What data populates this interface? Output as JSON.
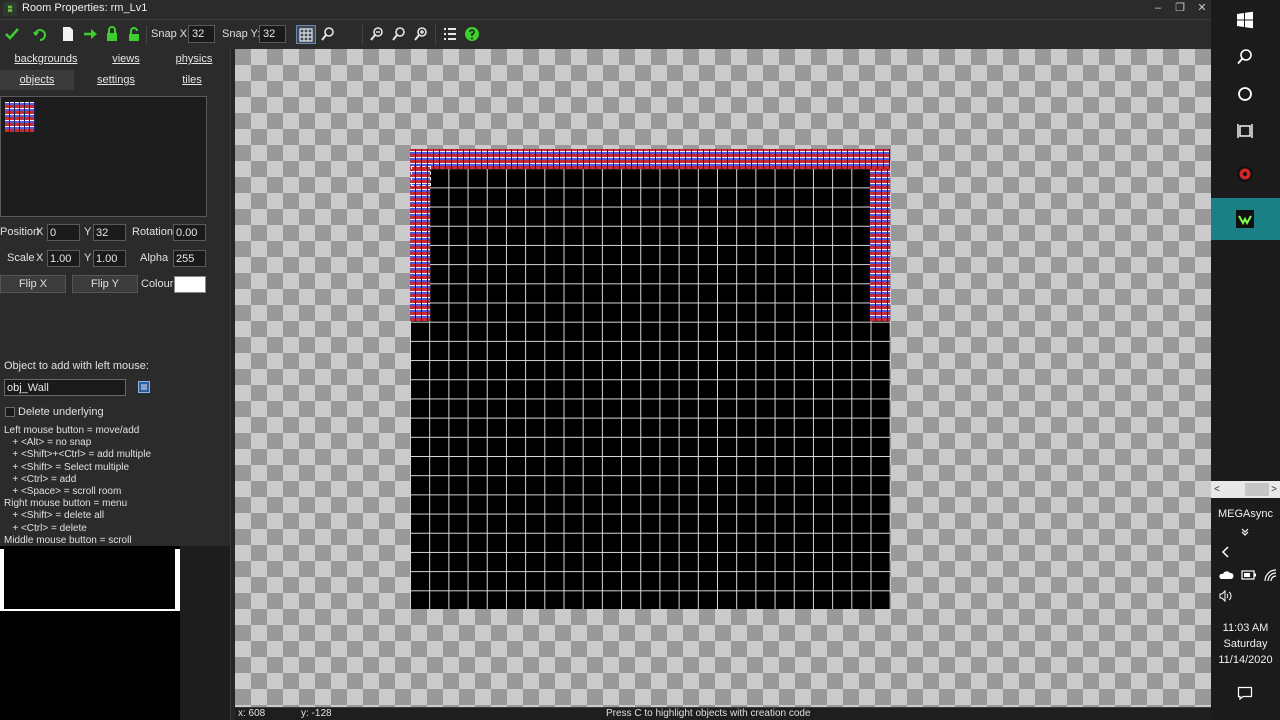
{
  "window": {
    "title": "Room Properties: rm_Lv1",
    "minimize": "–",
    "restore": "❐",
    "close": "✕",
    "app_icon": "gm-logo-icon"
  },
  "toolbar": {
    "snap_x_label": "Snap X:",
    "snap_x_value": "32",
    "snap_y_label": "Snap Y:",
    "snap_y_value": "32"
  },
  "tabs": {
    "row1": [
      "backgrounds",
      "views",
      "physics"
    ],
    "row2": [
      "objects",
      "settings",
      "tiles"
    ],
    "selected": "objects"
  },
  "props": {
    "position_label": "Position",
    "x_label": "X",
    "x_value": "0",
    "y_label": "Y",
    "y_value": "32",
    "rotation_label": "Rotation",
    "rotation_value": "0.00",
    "scale_label": "Scale",
    "scale_x_value": "1.00",
    "scale_y_value": "1.00",
    "alpha_label": "Alpha",
    "alpha_value": "255",
    "flip_x": "Flip X",
    "flip_y": "Flip Y",
    "colour_label": "Colour",
    "colour_value": "#ffffff"
  },
  "object_add": {
    "label": "Object to add with left mouse:",
    "value": "obj_Wall",
    "delete_underlying": "Delete underlying"
  },
  "help": [
    "Left mouse button = move/add",
    "   + <Alt> = no snap",
    "   + <Shift>+<Ctrl> = add multiple",
    "   + <Shift> = Select multiple",
    "   + <Ctrl> = add",
    "   + <Space> = scroll room",
    "Right mouse button = menu",
    "   + <Shift> = delete all",
    "   + <Ctrl> = delete",
    "Middle mouse button = scroll"
  ],
  "status": {
    "x": "x: 608",
    "y": "y: -128",
    "hint": "Press C to highlight objects with creation code"
  },
  "taskbar": {
    "tray_left": "<",
    "tray_right": ">",
    "mega": "MEGAsync",
    "time": "11:03 AM",
    "day": "Saturday",
    "date": "11/14/2020"
  }
}
